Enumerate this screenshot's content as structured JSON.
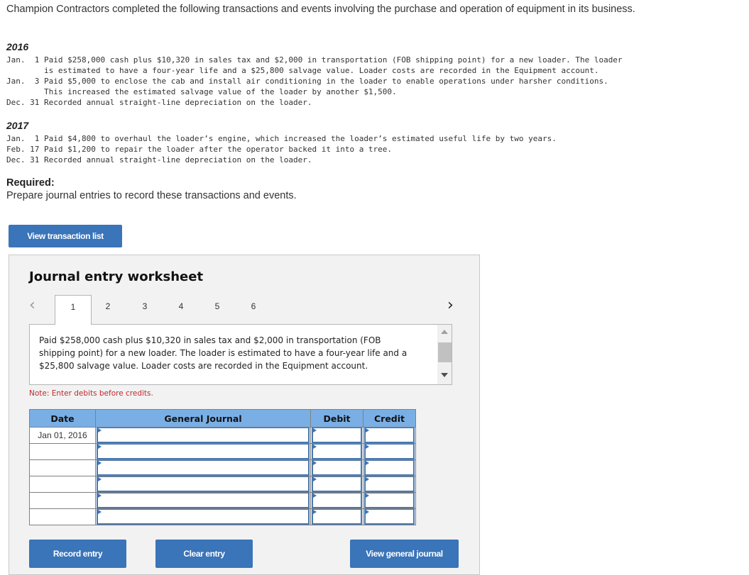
{
  "intro": "Champion Contractors completed the following transactions and events involving the purchase and operation of equipment in its business.",
  "years": [
    {
      "year": "2016",
      "lines": [
        "Jan.  1 Paid $258,000 cash plus $10,320 in sales tax and $2,000 in transportation (FOB shipping point) for a new loader. The loader",
        "        is estimated to have a four-year life and a $25,800 salvage value. Loader costs are recorded in the Equipment account.",
        "Jan.  3 Paid $5,000 to enclose the cab and install air conditioning in the loader to enable operations under harsher conditions.",
        "        This increased the estimated salvage value of the loader by another $1,500.",
        "Dec. 31 Recorded annual straight-line depreciation on the loader."
      ]
    },
    {
      "year": "2017",
      "lines": [
        "Jan.  1 Paid $4,800 to overhaul the loader’s engine, which increased the loader’s estimated useful life by two years.",
        "Feb. 17 Paid $1,200 to repair the loader after the operator backed it into a tree.",
        "Dec. 31 Recorded annual straight-line depreciation on the loader."
      ]
    }
  ],
  "required": {
    "label": "Required:",
    "text": "Prepare journal entries to record these transactions and events."
  },
  "buttons": {
    "view_transaction_list": "View transaction list",
    "record_entry": "Record entry",
    "clear_entry": "Clear entry",
    "view_general_journal": "View general journal"
  },
  "worksheet": {
    "title": "Journal entry worksheet",
    "prev_icon": "‹",
    "next_icon": "›",
    "tabs": [
      "1",
      "2",
      "3",
      "4",
      "5",
      "6"
    ],
    "active_tab": "1",
    "description": "Paid $258,000 cash plus $10,320 in sales tax and $2,000 in transportation (FOB shipping point) for a new loader. The loader is estimated to have a four-year life and a $25,800 salvage value. Loader costs are recorded in the Equipment account.",
    "note": "Note: Enter debits before credits.",
    "table": {
      "headers": [
        "Date",
        "General Journal",
        "Debit",
        "Credit"
      ],
      "rows": [
        {
          "date": "Jan 01, 2016",
          "account": "",
          "debit": "",
          "credit": ""
        },
        {
          "date": "",
          "account": "",
          "debit": "",
          "credit": ""
        },
        {
          "date": "",
          "account": "",
          "debit": "",
          "credit": ""
        },
        {
          "date": "",
          "account": "",
          "debit": "",
          "credit": ""
        },
        {
          "date": "",
          "account": "",
          "debit": "",
          "credit": ""
        },
        {
          "date": "",
          "account": "",
          "debit": "",
          "credit": ""
        }
      ]
    }
  },
  "colors": {
    "button_bg": "#3a74b9",
    "table_header_bg": "#7aafe6",
    "note_red": "#c0282d",
    "worksheet_bg": "#f2f2f2"
  }
}
